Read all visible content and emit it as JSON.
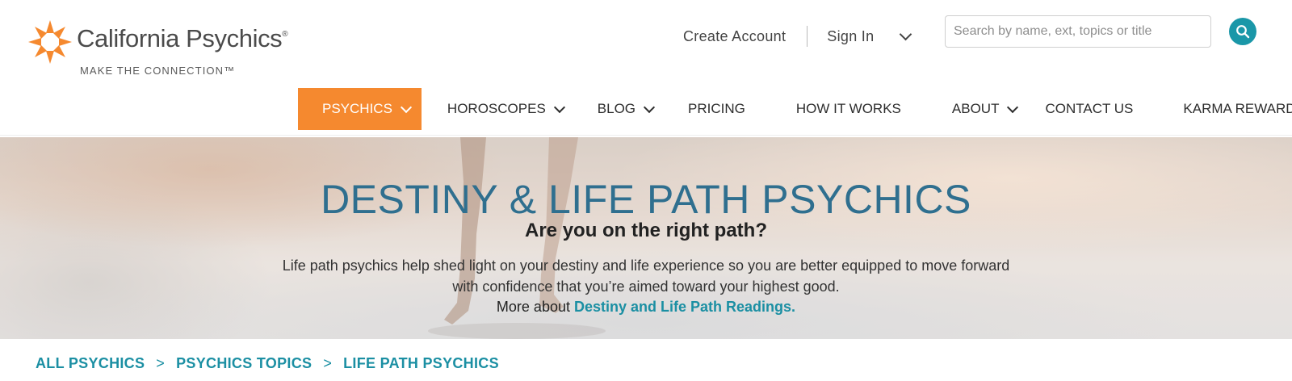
{
  "brand": {
    "name": "California Psychics",
    "registered": "®",
    "tagline": "MAKE THE CONNECTION™",
    "color": "#f5892f"
  },
  "header": {
    "create_account": "Create Account",
    "sign_in": "Sign In",
    "sign_in_icon": "chevron-down-icon",
    "search_placeholder": "Search by name, ext, topics or title",
    "search_value": "",
    "search_icon": "search-icon",
    "search_button_color": "#1a97a8"
  },
  "nav": {
    "items": [
      {
        "label": "PSYCHICS",
        "dropdown": true,
        "active": true
      },
      {
        "label": "HOROSCOPES",
        "dropdown": true
      },
      {
        "label": "BLOG",
        "dropdown": true
      },
      {
        "label": "PRICING",
        "dropdown": false
      },
      {
        "label": "HOW IT WORKS",
        "dropdown": false
      },
      {
        "label": "ABOUT",
        "dropdown": true
      },
      {
        "label": "CONTACT US",
        "dropdown": false
      },
      {
        "label": "KARMA REWARDS",
        "dropdown": false
      }
    ],
    "active_color": "#f5892f"
  },
  "hero": {
    "title": "DESTINY & LIFE PATH PSYCHICS",
    "subtitle": "Are you on the right path?",
    "description": "Life path psychics help shed light on your destiny and life experience so you are better equipped to move forward with confidence that you’re aimed toward your highest good.",
    "more_prefix": "More about",
    "more_link": "Destiny and Life Path Readings.",
    "title_color": "#2f6f8f",
    "link_color": "#1b8fa3"
  },
  "breadcrumb": {
    "items": [
      "ALL PSYCHICS",
      "PSYCHICS TOPICS",
      "LIFE PATH PSYCHICS"
    ],
    "separator": ">"
  }
}
